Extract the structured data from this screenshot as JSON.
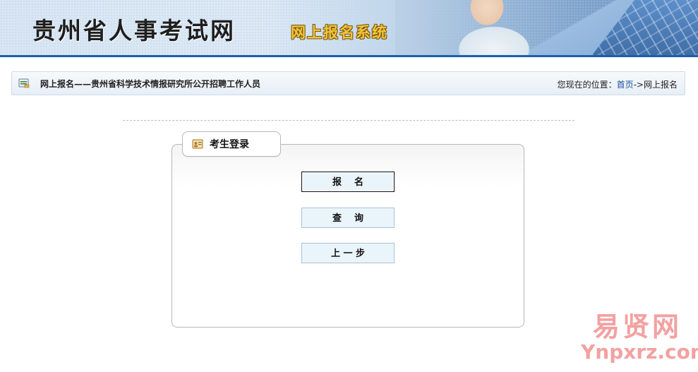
{
  "header": {
    "title": "贵州省人事考试网",
    "subtitle": "网上报名系统"
  },
  "breadcrumb_bar": {
    "heading": "网上报名——贵州省科学技术情报研究所公开招聘工作人员",
    "location_label": "您现在的位置：",
    "home_link": "首页",
    "separator": "->",
    "current": "网上报名"
  },
  "login_panel": {
    "tab_label": "考生登录",
    "buttons": {
      "register": "报    名",
      "query": "查    询",
      "back": "上 一 步"
    }
  },
  "watermark": {
    "line1": "易贤网",
    "line2": "Ynpxrz.com"
  },
  "colors": {
    "header_accent": "#1d5ea8",
    "link": "#1a4f9c",
    "button_bg": "#eaf4fb"
  },
  "icons": {
    "breadcrumb": "list-icon",
    "tab": "id-card-icon"
  }
}
